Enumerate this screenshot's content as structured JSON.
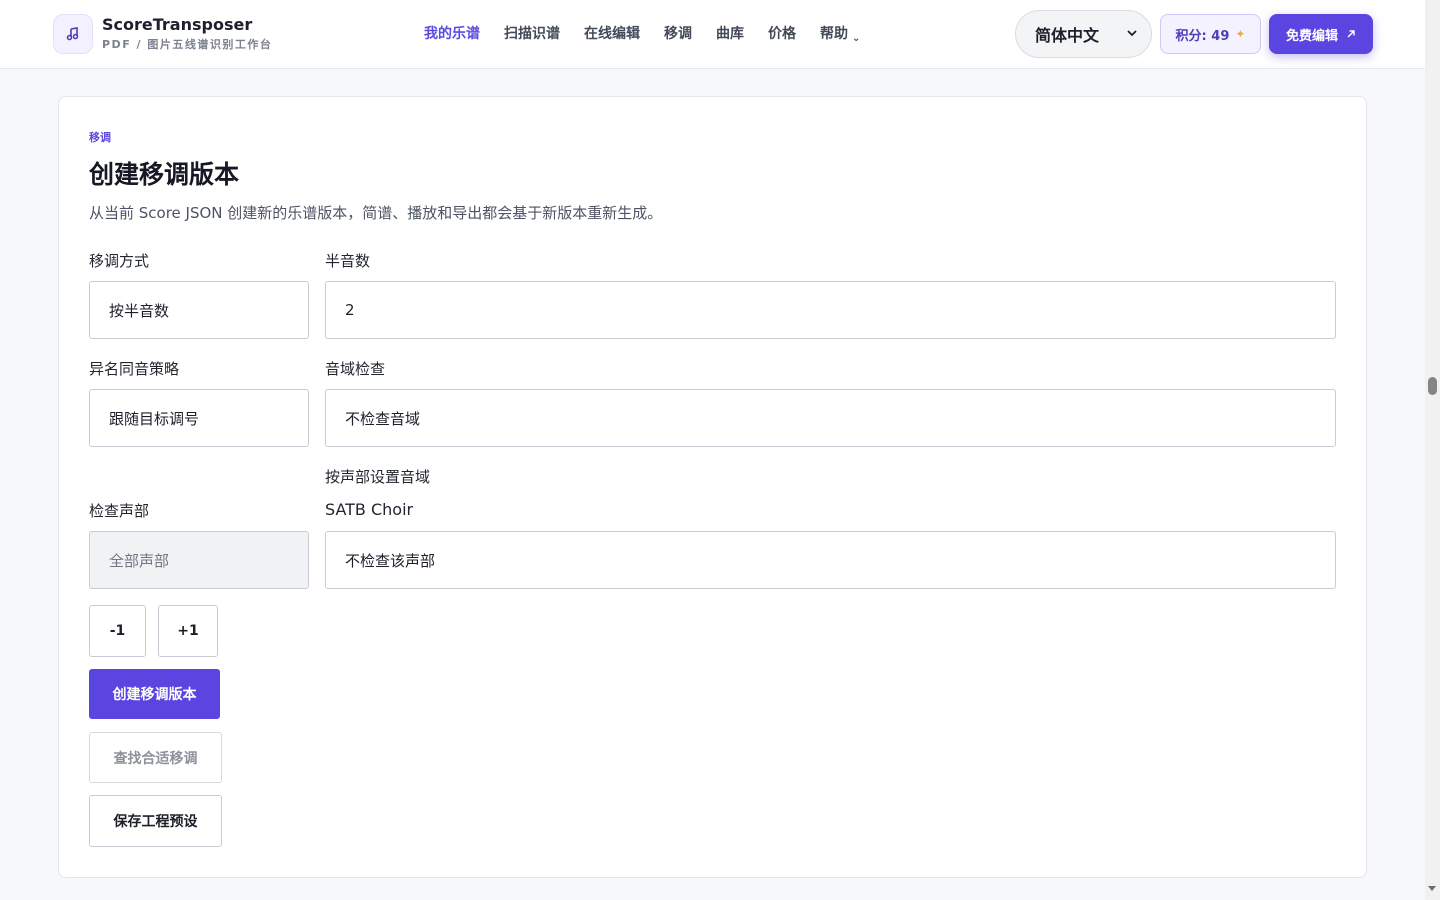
{
  "header": {
    "brand_name": "ScoreTransposer",
    "brand_sub": "PDF / 图片五线谱识别工作台",
    "nav": [
      {
        "label": "我的乐谱"
      },
      {
        "label": "扫描识谱"
      },
      {
        "label": "在线编辑"
      },
      {
        "label": "移调"
      },
      {
        "label": "曲库"
      },
      {
        "label": "价格"
      },
      {
        "label": "帮助"
      }
    ],
    "language": "简体中文",
    "points_label": "积分: 49",
    "free_edit_label": "免费编辑"
  },
  "section": {
    "eyebrow": "移调",
    "title": "创建移调版本",
    "description": "从当前 Score JSON 创建新的乐谱版本，简谱、播放和导出都会基于新版本重新生成。"
  },
  "form": {
    "mode_label": "移调方式",
    "mode_value": "按半音数",
    "semitones_label": "半音数",
    "semitones_value": "2",
    "enharmonic_label": "异名同音策略",
    "enharmonic_value": "跟随目标调号",
    "range_check_label": "音域检查",
    "range_check_value": "不检查音域",
    "voice_range_label": "按声部设置音域",
    "check_voice_label": "检查声部",
    "check_voice_value": "全部声部",
    "choir_label": "SATB Choir",
    "choir_value": "不检查该声部"
  },
  "buttons": {
    "minus": "-1",
    "plus": "+1",
    "create": "创建移调版本",
    "find": "查找合适移调",
    "save_preset": "保存工程预设"
  },
  "colors": {
    "accent": "#5b45e0",
    "accent_text": "#5b4be0",
    "spark": "#f2a93b"
  }
}
